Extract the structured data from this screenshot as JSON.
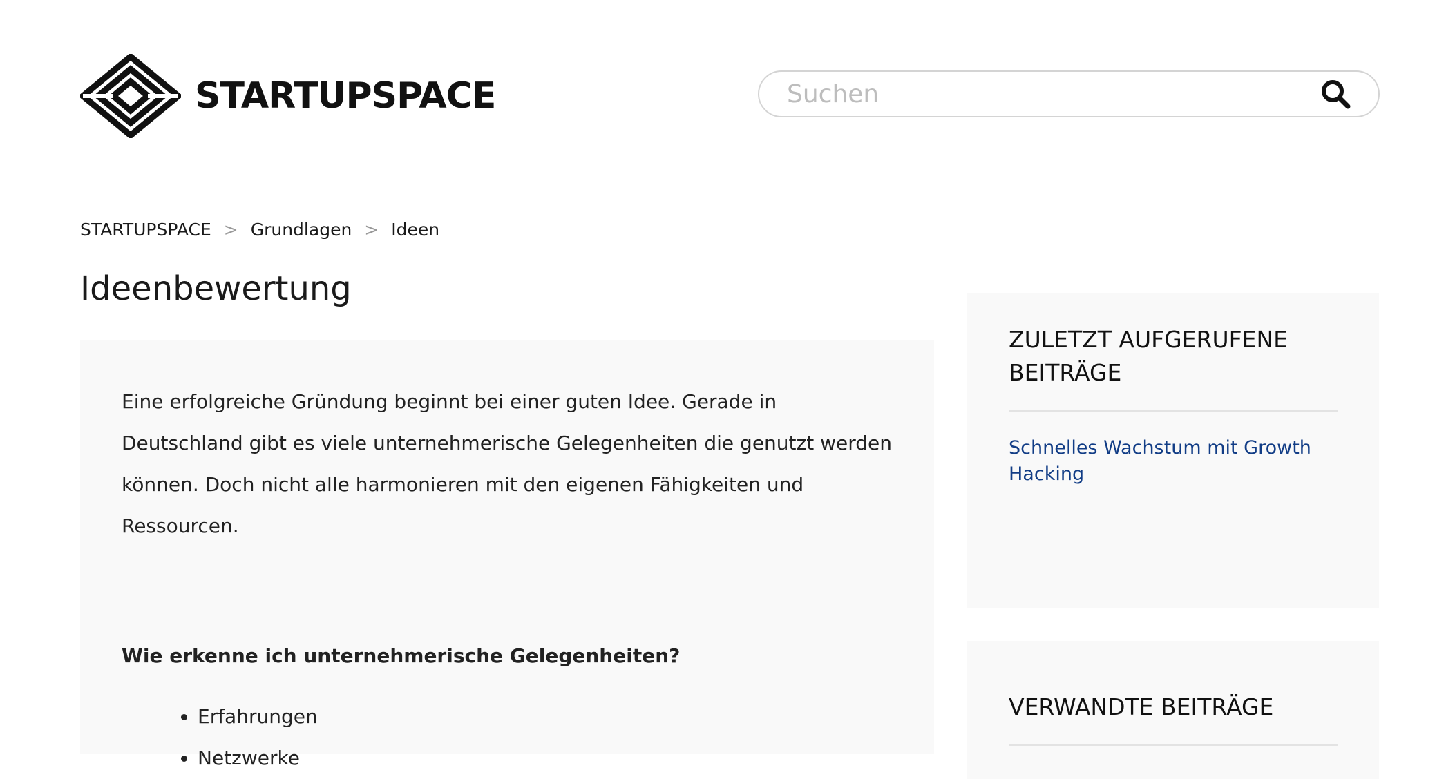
{
  "header": {
    "logo_text": "STARTUPSPACE",
    "search_placeholder": "Suchen"
  },
  "breadcrumb": {
    "items": [
      "STARTUPSPACE",
      "Grundlagen",
      "Ideen"
    ],
    "separator": ">"
  },
  "page": {
    "title": "Ideenbewertung"
  },
  "article": {
    "intro": "Eine erfolgreiche Gründung beginnt bei einer guten Idee. Gerade in Deutschland gibt es viele unternehmerische Gelegenheiten die genutzt werden können. Doch nicht alle harmonieren mit den eigenen Fähigkeiten und Ressourcen.",
    "subheading": "Wie erkenne ich unternehmerische Gelegenheiten?",
    "bullets": [
      "Erfahrungen",
      "Netzwerke"
    ]
  },
  "sidebar": {
    "recent": {
      "heading": "ZULETZT AUFGERUFENE BEITRÄGE",
      "links": [
        "Schnelles Wachstum mit Growth Hacking"
      ]
    },
    "related": {
      "heading": "VERWANDTE BEITRÄGE"
    }
  },
  "icons": {
    "logo": "startupspace-diamond-logo-icon",
    "search": "search-icon"
  },
  "colors": {
    "link": "#123d86",
    "panel_bg": "#f9f9f9",
    "text": "#1a1a1a"
  }
}
